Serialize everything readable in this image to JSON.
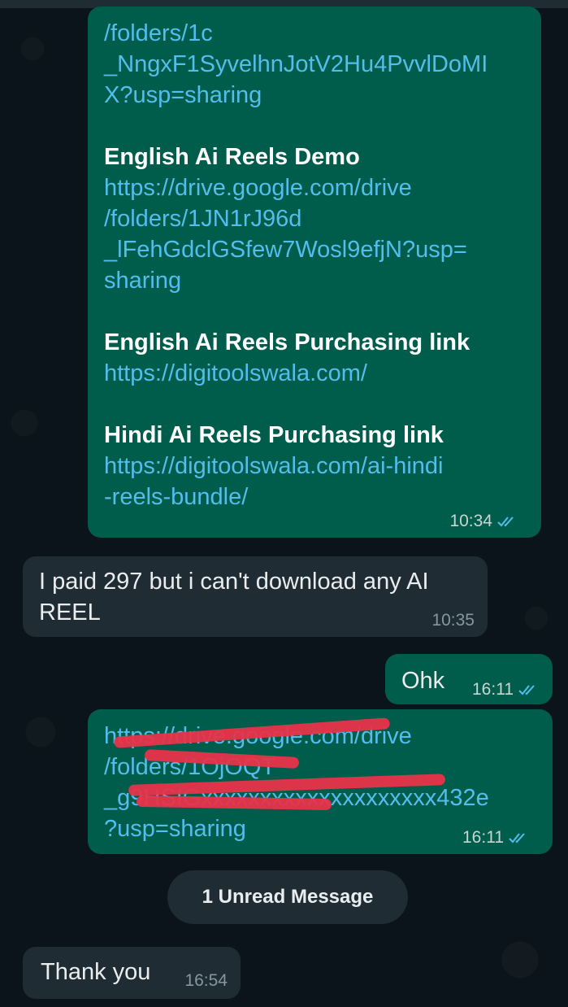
{
  "messages": [
    {
      "lines": [
        {
          "style": "link",
          "text": "/folders/1c"
        },
        {
          "style": "link",
          "text": "_NngxF1SyvelhnJotV2Hu4PvvlDoMI"
        },
        {
          "style": "link",
          "text": "X?usp=sharing"
        },
        {
          "style": "gap",
          "text": ""
        },
        {
          "style": "bold",
          "text": "English Ai Reels Demo"
        },
        {
          "style": "link",
          "text": "https://drive.google.com/drive"
        },
        {
          "style": "link",
          "text": "/folders/1JN1rJ96d"
        },
        {
          "style": "link",
          "text": "_lFehGdclGSfew7Wosl9efjN?usp="
        },
        {
          "style": "link",
          "text": "sharing"
        },
        {
          "style": "gap",
          "text": ""
        },
        {
          "style": "bold",
          "text": "English Ai Reels Purchasing link"
        },
        {
          "style": "link",
          "text": "https://digitoolswala.com/"
        },
        {
          "style": "gap",
          "text": ""
        },
        {
          "style": "bold",
          "text": "Hindi Ai Reels Purchasing link"
        },
        {
          "style": "link",
          "text": "https://digitoolswala.com/ai-hindi"
        },
        {
          "style": "link",
          "text": "-reels-bundle/"
        }
      ],
      "time": "10:34",
      "direction": "outgoing",
      "read": true
    },
    {
      "lines": [
        {
          "style": "text",
          "text": "I paid 297 but i can't download any AI"
        },
        {
          "style": "text",
          "text": "REEL"
        }
      ],
      "time": "10:35",
      "direction": "incoming"
    },
    {
      "lines": [
        {
          "style": "text",
          "text": "Ohk"
        }
      ],
      "time": "16:11",
      "direction": "outgoing",
      "read": true
    },
    {
      "lines": [
        {
          "style": "link",
          "text": "https://drive.google.com/drive"
        },
        {
          "style": "link",
          "text": "/folders/1OjOQT"
        },
        {
          "style": "link",
          "text": "_g9HSIGxxxxxxxxxxxxxxxxxxxx432e"
        },
        {
          "style": "link",
          "text": "?usp=sharing"
        }
      ],
      "time": "16:11",
      "direction": "outgoing",
      "read": true,
      "redacted": true
    },
    {
      "lines": [
        {
          "style": "text",
          "text": "Thank you"
        }
      ],
      "time": "16:54",
      "direction": "incoming"
    }
  ],
  "unread_banner": "1 Unread Message",
  "colors": {
    "background": "#0b141a",
    "outgoing_bubble": "#005c4b",
    "incoming_bubble": "#202c33",
    "link": "#53bdeb",
    "read_ticks": "#53bdeb",
    "redaction": "#e8334a"
  }
}
